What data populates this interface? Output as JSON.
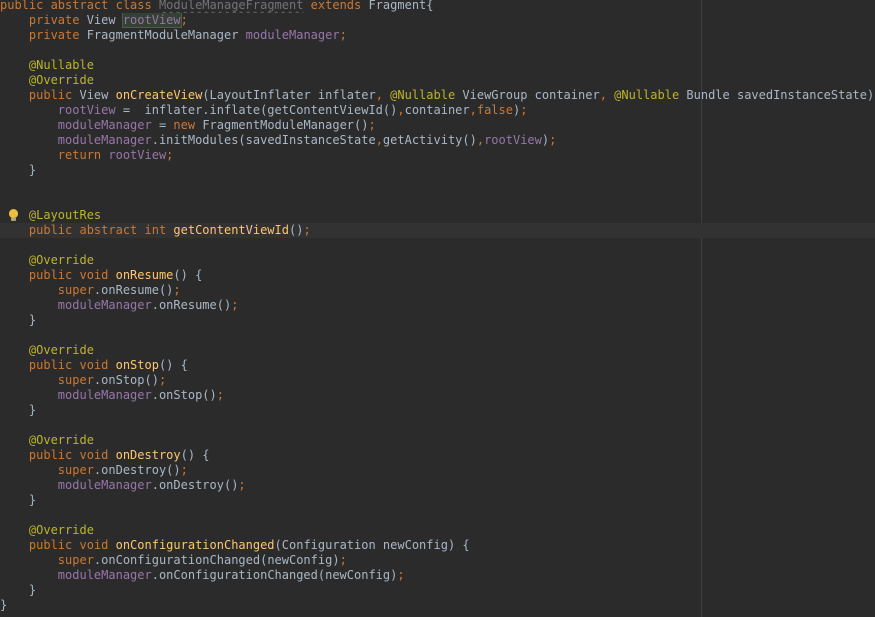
{
  "editor": {
    "lines": [
      [
        {
          "t": "public abstract class ",
          "c": "kw"
        },
        {
          "t": "ModuleManageFragment",
          "c": "unused"
        },
        {
          "t": " extends ",
          "c": "kw"
        },
        {
          "t": "Fragment{",
          "c": "txt"
        }
      ],
      [
        {
          "t": "    private ",
          "c": "kw"
        },
        {
          "t": "View ",
          "c": "txt"
        },
        {
          "t": "rootView",
          "c": "hl-usage"
        },
        {
          "t": ";",
          "c": "kw"
        }
      ],
      [
        {
          "t": "    private ",
          "c": "kw"
        },
        {
          "t": "FragmentModuleManager ",
          "c": "txt"
        },
        {
          "t": "moduleManager",
          "c": "fld"
        },
        {
          "t": ";",
          "c": "kw"
        }
      ],
      [],
      [
        {
          "t": "    @Nullable",
          "c": "ann"
        }
      ],
      [
        {
          "t": "    @Override",
          "c": "ann"
        }
      ],
      [
        {
          "t": "    public ",
          "c": "kw"
        },
        {
          "t": "View ",
          "c": "txt"
        },
        {
          "t": "onCreateView",
          "c": "fn"
        },
        {
          "t": "(LayoutInflater inflater",
          "c": "txt"
        },
        {
          "t": ", ",
          "c": "kw"
        },
        {
          "t": "@Nullable ",
          "c": "ann"
        },
        {
          "t": "ViewGroup container",
          "c": "txt"
        },
        {
          "t": ", ",
          "c": "kw"
        },
        {
          "t": "@Nullable ",
          "c": "ann"
        },
        {
          "t": "Bundle savedInstanceState) {",
          "c": "txt"
        }
      ],
      [
        {
          "t": "        ",
          "c": "txt"
        },
        {
          "t": "rootView",
          "c": "fld"
        },
        {
          "t": " =  inflater.inflate(getContentViewId()",
          "c": "txt"
        },
        {
          "t": ",",
          "c": "kw"
        },
        {
          "t": "container",
          "c": "txt"
        },
        {
          "t": ",",
          "c": "kw"
        },
        {
          "t": "false",
          "c": "kw"
        },
        {
          "t": ")",
          "c": "txt"
        },
        {
          "t": ";",
          "c": "kw"
        }
      ],
      [
        {
          "t": "        ",
          "c": "txt"
        },
        {
          "t": "moduleManager",
          "c": "fld"
        },
        {
          "t": " = ",
          "c": "txt"
        },
        {
          "t": "new ",
          "c": "kw"
        },
        {
          "t": "FragmentModuleManager()",
          "c": "txt"
        },
        {
          "t": ";",
          "c": "kw"
        }
      ],
      [
        {
          "t": "        ",
          "c": "txt"
        },
        {
          "t": "moduleManager",
          "c": "fld"
        },
        {
          "t": ".initModules(savedInstanceState",
          "c": "txt"
        },
        {
          "t": ",",
          "c": "kw"
        },
        {
          "t": "getActivity()",
          "c": "txt"
        },
        {
          "t": ",",
          "c": "kw"
        },
        {
          "t": "rootView",
          "c": "fld"
        },
        {
          "t": ")",
          "c": "txt"
        },
        {
          "t": ";",
          "c": "kw"
        }
      ],
      [
        {
          "t": "        return ",
          "c": "kw"
        },
        {
          "t": "rootView",
          "c": "fld"
        },
        {
          "t": ";",
          "c": "kw"
        }
      ],
      [
        {
          "t": "    }",
          "c": "txt"
        }
      ],
      [],
      [],
      [
        {
          "t": "    @LayoutRes",
          "c": "ann"
        }
      ],
      [
        {
          "t": "    public abstract int ",
          "c": "kw"
        },
        {
          "t": "getContentViewId",
          "c": "fn"
        },
        {
          "t": "()",
          "c": "txt"
        },
        {
          "t": ";",
          "c": "kw"
        }
      ],
      [],
      [
        {
          "t": "    @Override",
          "c": "ann"
        }
      ],
      [
        {
          "t": "    public void ",
          "c": "kw"
        },
        {
          "t": "onResume",
          "c": "fn"
        },
        {
          "t": "() {",
          "c": "txt"
        }
      ],
      [
        {
          "t": "        super",
          "c": "kw"
        },
        {
          "t": ".onResume()",
          "c": "txt"
        },
        {
          "t": ";",
          "c": "kw"
        }
      ],
      [
        {
          "t": "        ",
          "c": "txt"
        },
        {
          "t": "moduleManager",
          "c": "fld"
        },
        {
          "t": ".onResume()",
          "c": "txt"
        },
        {
          "t": ";",
          "c": "kw"
        }
      ],
      [
        {
          "t": "    }",
          "c": "txt"
        }
      ],
      [],
      [
        {
          "t": "    @Override",
          "c": "ann"
        }
      ],
      [
        {
          "t": "    public void ",
          "c": "kw"
        },
        {
          "t": "onStop",
          "c": "fn"
        },
        {
          "t": "() {",
          "c": "txt"
        }
      ],
      [
        {
          "t": "        super",
          "c": "kw"
        },
        {
          "t": ".onStop()",
          "c": "txt"
        },
        {
          "t": ";",
          "c": "kw"
        }
      ],
      [
        {
          "t": "        ",
          "c": "txt"
        },
        {
          "t": "moduleManager",
          "c": "fld"
        },
        {
          "t": ".onStop()",
          "c": "txt"
        },
        {
          "t": ";",
          "c": "kw"
        }
      ],
      [
        {
          "t": "    }",
          "c": "txt"
        }
      ],
      [],
      [
        {
          "t": "    @Override",
          "c": "ann"
        }
      ],
      [
        {
          "t": "    public void ",
          "c": "kw"
        },
        {
          "t": "onDestroy",
          "c": "fn"
        },
        {
          "t": "() {",
          "c": "txt"
        }
      ],
      [
        {
          "t": "        super",
          "c": "kw"
        },
        {
          "t": ".onDestroy()",
          "c": "txt"
        },
        {
          "t": ";",
          "c": "kw"
        }
      ],
      [
        {
          "t": "        ",
          "c": "txt"
        },
        {
          "t": "moduleManager",
          "c": "fld"
        },
        {
          "t": ".onDestroy()",
          "c": "txt"
        },
        {
          "t": ";",
          "c": "kw"
        }
      ],
      [
        {
          "t": "    }",
          "c": "txt"
        }
      ],
      [],
      [
        {
          "t": "    @Override",
          "c": "ann"
        }
      ],
      [
        {
          "t": "    public void ",
          "c": "kw"
        },
        {
          "t": "onConfigurationChanged",
          "c": "fn"
        },
        {
          "t": "(Configuration newConfig) {",
          "c": "txt"
        }
      ],
      [
        {
          "t": "        super",
          "c": "kw"
        },
        {
          "t": ".onConfigurationChanged(newConfig)",
          "c": "txt"
        },
        {
          "t": ";",
          "c": "kw"
        }
      ],
      [
        {
          "t": "        ",
          "c": "txt"
        },
        {
          "t": "moduleManager",
          "c": "fld"
        },
        {
          "t": ".onConfigurationChanged(newConfig)",
          "c": "txt"
        },
        {
          "t": ";",
          "c": "kw"
        }
      ],
      [
        {
          "t": "    }",
          "c": "txt"
        }
      ],
      [
        {
          "t": "}",
          "c": "txt"
        }
      ]
    ],
    "intention_icon": "lightbulb-icon",
    "colors": {
      "background": "#2b2b2b",
      "keyword": "#cc7832",
      "annotation": "#bbb529",
      "field": "#9876aa",
      "method": "#ffc66d",
      "text": "#a9b7c6",
      "unused": "#72737a",
      "usage_highlight": "#344134",
      "caret_line": "#323232"
    }
  }
}
